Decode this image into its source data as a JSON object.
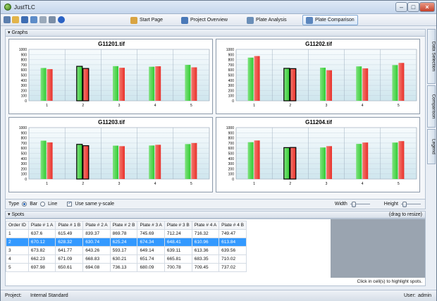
{
  "window": {
    "title": "JustTLC"
  },
  "toolbar": {
    "nav": [
      {
        "label": "Start Page",
        "icon": "start-page-icon"
      },
      {
        "label": "Project Overview",
        "icon": "project-overview-icon"
      },
      {
        "label": "Plate Analysis",
        "icon": "plate-analysis-icon"
      },
      {
        "label": "Plate Comparison",
        "icon": "plate-comparison-icon",
        "active": true
      }
    ]
  },
  "graphs": {
    "header": "Graphs",
    "controls": {
      "type_label": "Type",
      "bar_label": "Bar",
      "line_label": "Line",
      "selected_type": "Bar",
      "same_scale_label": "Use same y-scale",
      "same_scale_checked": true,
      "width_label": "Width",
      "height_label": "Height",
      "width_slider_value": 0.1,
      "height_slider_value": 0.1
    }
  },
  "chart_data": [
    {
      "type": "bar",
      "title": "G11201.tif",
      "categories": [
        "1",
        "2",
        "3",
        "4",
        "5"
      ],
      "ylim": [
        0,
        1000
      ],
      "yticks": [
        0,
        100,
        200,
        300,
        400,
        500,
        600,
        700,
        800,
        900,
        1000
      ],
      "series": [
        {
          "values": [
            637.6,
            670.12,
            673.82,
            662.23,
            697.98
          ]
        },
        {
          "values": [
            615.49,
            628.32,
            641.77,
            671.09,
            650.61
          ]
        }
      ],
      "highlight_index": 1,
      "colors": [
        "#33cc33",
        "#e8302a"
      ]
    },
    {
      "type": "bar",
      "title": "G11202.tif",
      "categories": [
        "1",
        "2",
        "3",
        "4",
        "5"
      ],
      "ylim": [
        0,
        1000
      ],
      "yticks": [
        0,
        100,
        200,
        300,
        400,
        500,
        600,
        700,
        800,
        900,
        1000
      ],
      "series": [
        {
          "values": [
            839.37,
            630.74,
            643.26,
            668.83,
            694.08
          ]
        },
        {
          "values": [
            869.78,
            625.24,
            593.17,
            630.21,
            736.13
          ]
        }
      ],
      "highlight_index": 1,
      "colors": [
        "#33cc33",
        "#e8302a"
      ]
    },
    {
      "type": "bar",
      "title": "G11203.tif",
      "categories": [
        "1",
        "2",
        "3",
        "4",
        "5"
      ],
      "ylim": [
        0,
        1000
      ],
      "yticks": [
        0,
        100,
        200,
        300,
        400,
        500,
        600,
        700,
        800,
        900,
        1000
      ],
      "series": [
        {
          "values": [
            745.69,
            674.34,
            649.14,
            651.74,
            680.09
          ]
        },
        {
          "values": [
            712.24,
            648.41,
            639.11,
            665.81,
            700.78
          ]
        }
      ],
      "highlight_index": 1,
      "colors": [
        "#33cc33",
        "#e8302a"
      ]
    },
    {
      "type": "bar",
      "title": "G11204.tif",
      "categories": [
        "1",
        "2",
        "3",
        "4",
        "5"
      ],
      "ylim": [
        0,
        1000
      ],
      "yticks": [
        0,
        100,
        200,
        300,
        400,
        500,
        600,
        700,
        800,
        900,
        1000
      ],
      "series": [
        {
          "values": [
            716.32,
            610.96,
            613.36,
            683.35,
            709.45
          ]
        },
        {
          "values": [
            749.47,
            613.84,
            639.56,
            710.02,
            737.02
          ]
        }
      ],
      "highlight_index": 1,
      "colors": [
        "#33cc33",
        "#e8302a"
      ]
    }
  ],
  "spots": {
    "header": "Spots",
    "resize_hint": "(drag to resize)",
    "columns": [
      "Order ID",
      "Plate # 1 A",
      "Plate # 1 B",
      "Plate # 2 A",
      "Plate # 2 B",
      "Plate # 3 A",
      "Plate # 3 B",
      "Plate # 4 A",
      "Plate # 4 B"
    ],
    "rows": [
      [
        "1",
        "637.6",
        "615.49",
        "839.37",
        "869.78",
        "745.69",
        "712.24",
        "716.32",
        "749.47"
      ],
      [
        "2",
        "670.12",
        "628.32",
        "630.74",
        "625.24",
        "674.34",
        "648.41",
        "610.96",
        "613.84"
      ],
      [
        "3",
        "673.82",
        "641.77",
        "643.26",
        "593.17",
        "649.14",
        "639.11",
        "613.36",
        "639.56"
      ],
      [
        "4",
        "662.23",
        "671.09",
        "668.83",
        "630.21",
        "651.74",
        "665.81",
        "683.35",
        "710.02"
      ],
      [
        "5",
        "697.98",
        "650.61",
        "694.08",
        "736.13",
        "680.09",
        "700.78",
        "709.45",
        "737.02"
      ]
    ],
    "selected_row": 1,
    "click_hint": "Click in cell(s) to highlight spots."
  },
  "side_tabs": [
    "Data Selection",
    "Comparison",
    "Legend"
  ],
  "status": {
    "project_label": "Project:",
    "project_value": "Internal Standard",
    "user_label": "User:",
    "user_value": "admin"
  }
}
